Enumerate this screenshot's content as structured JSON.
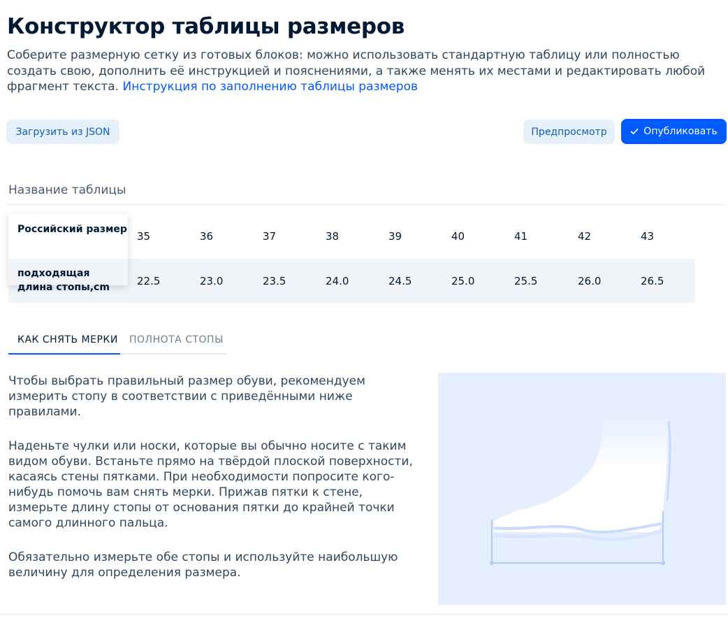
{
  "page": {
    "title": "Конструктор таблицы размеров",
    "description": "Соберите размерную сетку из готовых блоков: можно использовать стандартную таблицу или полностью создать свою, дополнить её инструкцией и пояснениями, а также менять их местами и редактировать любой фрагмент текста.",
    "instruction_link": "Инструкция по заполнению таблицы размеров"
  },
  "toolbar": {
    "load_json_label": "Загрузить из JSON",
    "preview_label": "Предпросмотр",
    "publish_label": "Опубликовать"
  },
  "table": {
    "name_placeholder": "Название таблицы",
    "rows": [
      {
        "header": "Российский размер",
        "values": [
          "35",
          "36",
          "37",
          "38",
          "39",
          "40",
          "41",
          "42",
          "43"
        ]
      },
      {
        "header": "подходящая длина стопы,cm",
        "values": [
          "22.5",
          "23.0",
          "23.5",
          "24.0",
          "24.5",
          "25.0",
          "25.5",
          "26.0",
          "26.5"
        ]
      }
    ]
  },
  "tabs": [
    {
      "label": "КАК СНЯТЬ МЕРКИ",
      "active": true
    },
    {
      "label": "ПОЛНОТА СТОПЫ",
      "active": false
    }
  ],
  "instructions": {
    "paragraphs": [
      "Чтобы выбрать правильный размер обуви, рекомендуем измерить стопу в соответствии с приведёнными ниже правилами.",
      "Наденьте чулки или носки, которые вы обычно носите с таким видом обуви. Встаньте прямо на твёрдой плоской поверхности, касаясь стены пятками. При необходимости попросите кого-нибудь помочь вам снять мерки. Прижав пятки к стене, измерьте длину стопы от основания пятки до крайней точки самого длинного пальца.",
      "Обязательно измерьте обе стопы и используйте наибольшую величину для определения размера."
    ]
  },
  "icons": {
    "publish": "check-icon",
    "illustration": "foot-measurement-illustration"
  },
  "colors": {
    "accent": "#005bff",
    "light_button": "#e6f1fb",
    "illustration_bg": "#e5efff"
  }
}
